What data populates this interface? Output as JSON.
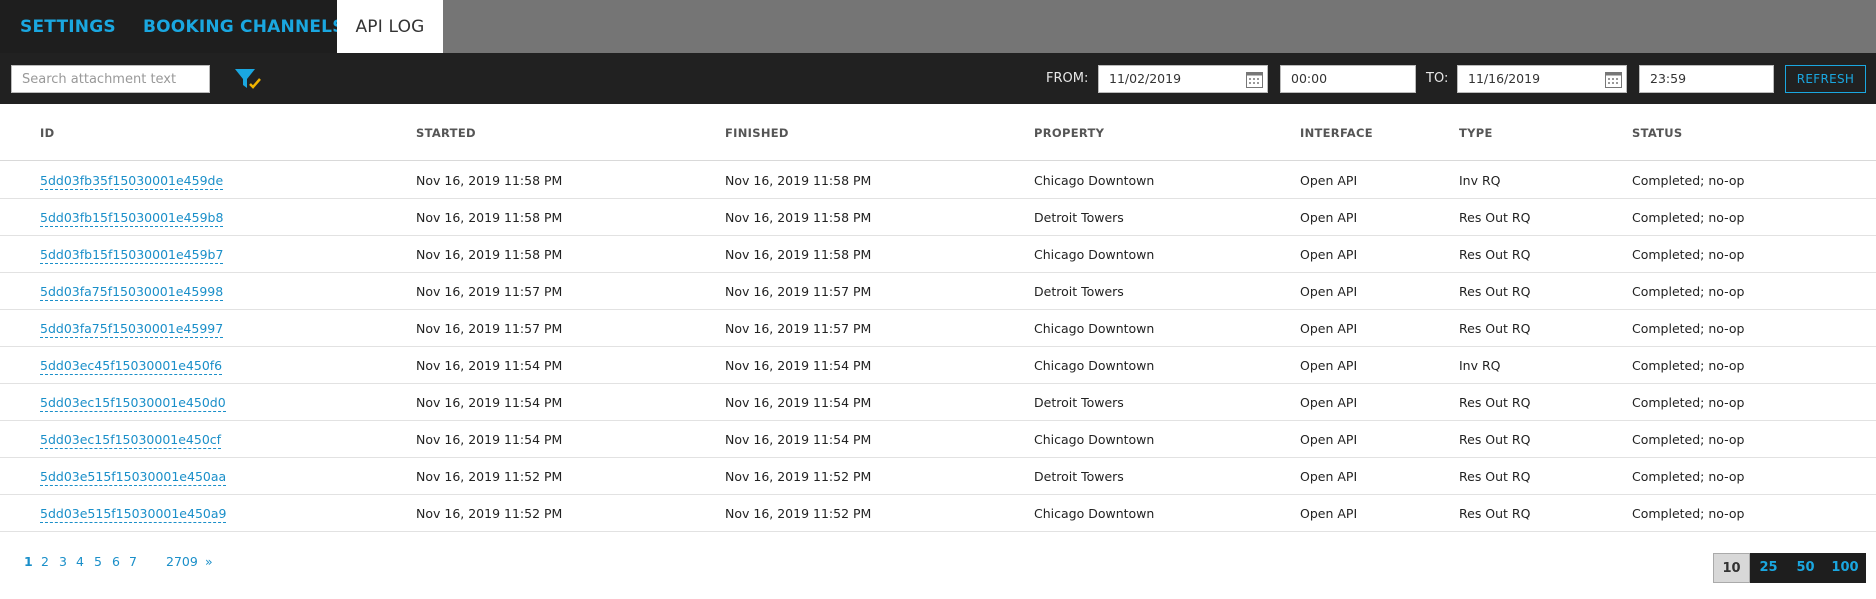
{
  "tabs": [
    {
      "label": "SETTINGS"
    },
    {
      "label": "BOOKING CHANNELS"
    },
    {
      "label": "API LOG"
    }
  ],
  "toolbar": {
    "search_placeholder": "Search attachment text",
    "from_label": "FROM:",
    "from_date": "11/02/2019",
    "from_time": "00:00",
    "to_label": "TO:",
    "to_date": "11/16/2019",
    "to_time": "23:59",
    "refresh_label": "REFRESH"
  },
  "table": {
    "headers": {
      "id": "ID",
      "started": "STARTED",
      "finished": "FINISHED",
      "property": "PROPERTY",
      "interface": "INTERFACE",
      "type": "TYPE",
      "status": "STATUS"
    },
    "rows": [
      {
        "id": "5dd03fb35f15030001e459de",
        "started": "Nov 16, 2019 11:58 PM",
        "finished": "Nov 16, 2019 11:58 PM",
        "property": "Chicago Downtown",
        "interface": "Open API",
        "type": "Inv RQ",
        "status": "Completed; no-op"
      },
      {
        "id": "5dd03fb15f15030001e459b8",
        "started": "Nov 16, 2019 11:58 PM",
        "finished": "Nov 16, 2019 11:58 PM",
        "property": "Detroit Towers",
        "interface": "Open API",
        "type": "Res Out RQ",
        "status": "Completed; no-op"
      },
      {
        "id": "5dd03fb15f15030001e459b7",
        "started": "Nov 16, 2019 11:58 PM",
        "finished": "Nov 16, 2019 11:58 PM",
        "property": "Chicago Downtown",
        "interface": "Open API",
        "type": "Res Out RQ",
        "status": "Completed; no-op"
      },
      {
        "id": "5dd03fa75f15030001e45998",
        "started": "Nov 16, 2019 11:57 PM",
        "finished": "Nov 16, 2019 11:57 PM",
        "property": "Detroit Towers",
        "interface": "Open API",
        "type": "Res Out RQ",
        "status": "Completed; no-op"
      },
      {
        "id": "5dd03fa75f15030001e45997",
        "started": "Nov 16, 2019 11:57 PM",
        "finished": "Nov 16, 2019 11:57 PM",
        "property": "Chicago Downtown",
        "interface": "Open API",
        "type": "Res Out RQ",
        "status": "Completed; no-op"
      },
      {
        "id": "5dd03ec45f15030001e450f6",
        "started": "Nov 16, 2019 11:54 PM",
        "finished": "Nov 16, 2019 11:54 PM",
        "property": "Chicago Downtown",
        "interface": "Open API",
        "type": "Inv RQ",
        "status": "Completed; no-op"
      },
      {
        "id": "5dd03ec15f15030001e450d0",
        "started": "Nov 16, 2019 11:54 PM",
        "finished": "Nov 16, 2019 11:54 PM",
        "property": "Detroit Towers",
        "interface": "Open API",
        "type": "Res Out RQ",
        "status": "Completed; no-op"
      },
      {
        "id": "5dd03ec15f15030001e450cf",
        "started": "Nov 16, 2019 11:54 PM",
        "finished": "Nov 16, 2019 11:54 PM",
        "property": "Chicago Downtown",
        "interface": "Open API",
        "type": "Res Out RQ",
        "status": "Completed; no-op"
      },
      {
        "id": "5dd03e515f15030001e450aa",
        "started": "Nov 16, 2019 11:52 PM",
        "finished": "Nov 16, 2019 11:52 PM",
        "property": "Detroit Towers",
        "interface": "Open API",
        "type": "Res Out RQ",
        "status": "Completed; no-op"
      },
      {
        "id": "5dd03e515f15030001e450a9",
        "started": "Nov 16, 2019 11:52 PM",
        "finished": "Nov 16, 2019 11:52 PM",
        "property": "Chicago Downtown",
        "interface": "Open API",
        "type": "Res Out RQ",
        "status": "Completed; no-op"
      }
    ]
  },
  "pagination": {
    "pages": [
      "1",
      "2",
      "3",
      "4",
      "5",
      "6",
      "7"
    ],
    "current": "1",
    "last": "2709",
    "next": "»"
  },
  "page_sizes": [
    "10",
    "25",
    "50",
    "100"
  ],
  "page_size_selected": "10",
  "colors": {
    "accent": "#1aa7e0",
    "toolbar_bg": "#212121",
    "tabbar_bg": "#757575",
    "link": "#1a8fc9"
  }
}
